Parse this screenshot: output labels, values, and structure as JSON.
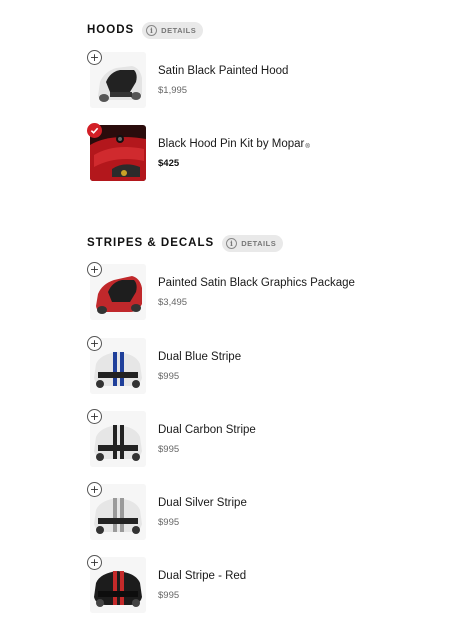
{
  "hoods": {
    "title": "HOODS",
    "details_label": "DETAILS",
    "items": [
      {
        "name": "Satin Black Painted Hood",
        "price": "$1,995",
        "selected": false
      },
      {
        "name": "Black Hood Pin Kit by Mopar",
        "mark": "®",
        "price": "$425",
        "selected": true
      }
    ]
  },
  "stripes": {
    "title": "STRIPES & DECALS",
    "details_label": "DETAILS",
    "items": [
      {
        "name": "Painted Satin Black Graphics Package",
        "price": "$3,495",
        "selected": false
      },
      {
        "name": "Dual Blue Stripe",
        "price": "$995",
        "selected": false
      },
      {
        "name": "Dual Carbon Stripe",
        "price": "$995",
        "selected": false
      },
      {
        "name": "Dual Silver Stripe",
        "price": "$995",
        "selected": false
      },
      {
        "name": "Dual Stripe - Red",
        "price": "$995",
        "selected": false
      }
    ]
  },
  "colors": {
    "accent_red": "#d21f26",
    "car_white": "#e9e9e9",
    "car_red": "#c0282b",
    "car_black": "#1c1c1c",
    "stripe_blue": "#1f3f9a",
    "stripe_carbon": "#222222",
    "stripe_silver": "#9a9a9a",
    "stripe_red": "#c42a2a"
  }
}
